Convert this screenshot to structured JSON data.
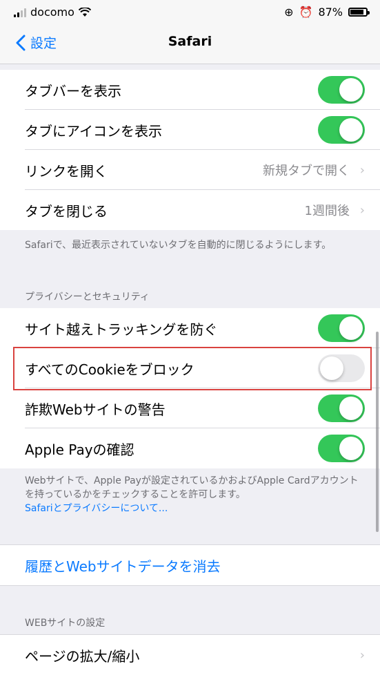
{
  "status": {
    "carrier": "docomo",
    "battery": "87%",
    "battery_level": 0.87
  },
  "nav": {
    "back_label": "設定",
    "title": "Safari"
  },
  "tabs_section": {
    "rows": [
      {
        "label": "タブバーを表示",
        "toggle": true
      },
      {
        "label": "タブにアイコンを表示",
        "toggle": true
      },
      {
        "label": "リンクを開く",
        "value": "新規タブで開く"
      },
      {
        "label": "タブを閉じる",
        "value": "1週間後"
      }
    ],
    "footnote": "Safariで、最近表示されていないタブを自動的に閉じるようにします。"
  },
  "privacy_section": {
    "header": "プライバシーとセキュリティ",
    "rows": [
      {
        "label": "サイト越えトラッキングを防ぐ",
        "toggle": true
      },
      {
        "label": "すべてのCookieをブロック",
        "toggle": false
      },
      {
        "label": "詐欺Webサイトの警告",
        "toggle": true
      },
      {
        "label": "Apple Payの確認",
        "toggle": true
      }
    ],
    "footnote": "Webサイトで、Apple Payが設定されているかおよびApple Cardアカウントを持っているかをチェックすることを許可します。",
    "link": "Safariとプライバシーについて..."
  },
  "clear_section": {
    "label": "履歴とWebサイトデータを消去"
  },
  "website_section": {
    "header": "WEBサイトの設定",
    "rows": [
      {
        "label": "ページの拡大/縮小"
      }
    ]
  },
  "colors": {
    "accent": "#0a7aff",
    "toggle_on": "#34c759",
    "highlight": "#d9423f"
  }
}
